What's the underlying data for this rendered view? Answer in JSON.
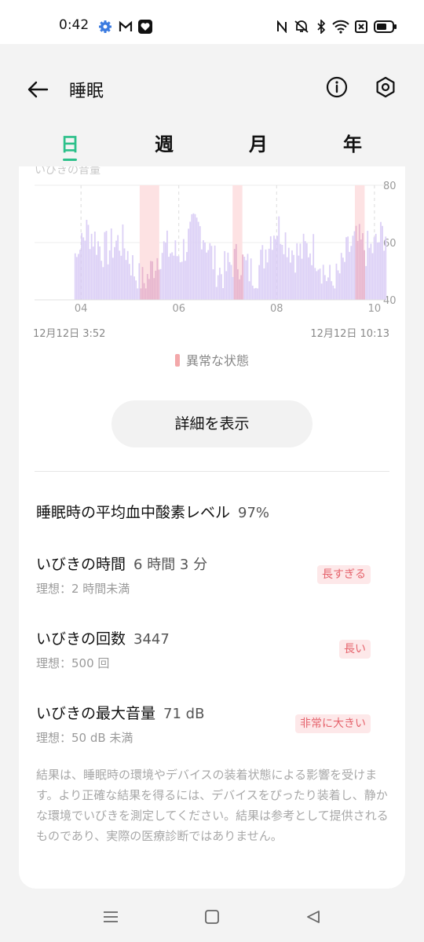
{
  "status_bar": {
    "time": "0:42",
    "left_icons": [
      "gear-icon",
      "gmail-icon",
      "heart-app-icon"
    ],
    "right_icons": [
      "nfc-icon",
      "mute-icon",
      "bluetooth-icon",
      "wifi-icon",
      "sim-off-icon",
      "battery-icon"
    ]
  },
  "header": {
    "title": "睡眠",
    "back_icon": "arrow-left-icon",
    "info_icon": "info-icon",
    "settings_icon": "hexagon-settings-icon"
  },
  "tabs": [
    {
      "label": "日",
      "active": true
    },
    {
      "label": "週",
      "active": false
    },
    {
      "label": "月",
      "active": false
    },
    {
      "label": "年",
      "active": false
    }
  ],
  "colors": {
    "accent": "#2cc08a",
    "bar": "#dcd0f6",
    "abnormal": "#f3a8aa",
    "badge_bg": "#fde8e9",
    "badge_text": "#e5636c"
  },
  "chart_data": {
    "type": "bar",
    "title": "いびきの音量",
    "x_ticks": [
      "04",
      "06",
      "08",
      "10"
    ],
    "y_ticks": [
      80,
      60,
      40
    ],
    "ylim": [
      40,
      80
    ],
    "x_start": "12月12日 3:52",
    "x_end": "12月12日 10:13",
    "legend": "異常な状態",
    "abnormal_periods_hours": [
      [
        5.2,
        5.6
      ],
      [
        7.1,
        7.3
      ],
      [
        9.6,
        9.8
      ]
    ]
  },
  "detail_button": "詳細を表示",
  "metrics": [
    {
      "title": "睡眠時の平均血中酸素レベル",
      "value": "97%"
    },
    {
      "title": "いびきの時間",
      "value": "6 時間 3 分",
      "ideal": "理想：2 時間未満",
      "badge": "長すぎる"
    },
    {
      "title": "いびきの回数",
      "value": "3447",
      "ideal": "理想：500 回",
      "badge": "長い"
    },
    {
      "title": "いびきの最大音量",
      "value": "71 dB",
      "ideal": "理想：50 dB 未満",
      "badge": "非常に大きい"
    }
  ],
  "disclaimer": "結果は、睡眠時の環境やデバイスの装着状態による影響を受けます。より正確な結果を得るには、デバイスをぴったり装着し、静かな環境でいびきを測定してください。結果は参考として提供されるものであり、実際の医療診断ではありません。",
  "nav": [
    "menu-icon",
    "home-square-icon",
    "back-triangle-icon"
  ]
}
